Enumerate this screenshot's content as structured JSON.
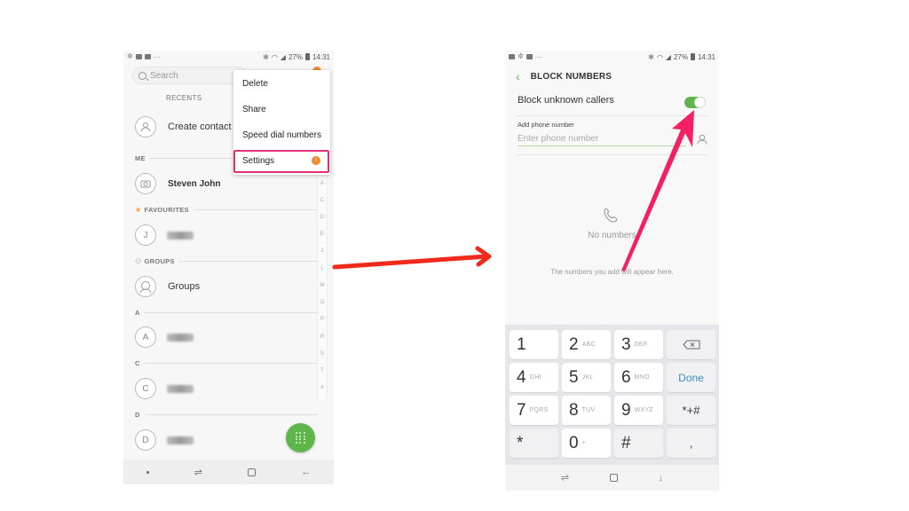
{
  "left_screen": {
    "status_bar": {
      "battery": "27%",
      "time": "14:31"
    },
    "search": {
      "placeholder": "Search"
    },
    "tabs": {
      "recents": "RECENTS"
    },
    "create_contact": "Create contact",
    "sections": {
      "me": "ME",
      "favourites": "FAVOURITES",
      "groups": "GROUPS",
      "a": "A",
      "c": "C",
      "d": "D"
    },
    "me_contact": "Steven John",
    "favourite_contact": {
      "initial": "J",
      "name": "(blurred)"
    },
    "groups_item": "Groups",
    "contacts": [
      {
        "initial": "A",
        "name": "(blurred)"
      },
      {
        "initial": "C",
        "name": "(blurred)"
      },
      {
        "initial": "D",
        "name": "(blurred)"
      }
    ],
    "index_letters": [
      "A",
      "C",
      "D",
      "E",
      "J",
      "L",
      "M",
      "O",
      "P",
      "R",
      "S",
      "T",
      "#"
    ],
    "menu": {
      "items": [
        "Delete",
        "Share",
        "Speed dial numbers",
        "Settings"
      ],
      "highlighted": "Settings",
      "settings_badge": "!"
    }
  },
  "right_screen": {
    "status_bar": {
      "battery": "27%",
      "time": "14:31"
    },
    "title": "BLOCK NUMBERS",
    "block_unknown_label": "Block unknown callers",
    "block_unknown_enabled": true,
    "add_phone_label": "Add phone number",
    "phone_input": {
      "placeholder": "Enter phone number",
      "value": ""
    },
    "empty_title": "No numbers",
    "empty_hint": "The numbers you add will appear here.",
    "keypad": [
      {
        "digit": "1",
        "letters": ""
      },
      {
        "digit": "2",
        "letters": "ABC"
      },
      {
        "digit": "3",
        "letters": "DEF"
      },
      {
        "digit": "backspace",
        "letters": ""
      },
      {
        "digit": "4",
        "letters": "GHI"
      },
      {
        "digit": "5",
        "letters": "JKL"
      },
      {
        "digit": "6",
        "letters": "MNO"
      },
      {
        "digit": "Done",
        "letters": ""
      },
      {
        "digit": "7",
        "letters": "PQRS"
      },
      {
        "digit": "8",
        "letters": "TUV"
      },
      {
        "digit": "9",
        "letters": "WXYZ"
      },
      {
        "digit": "*+#",
        "letters": ""
      },
      {
        "digit": "*",
        "letters": ""
      },
      {
        "digit": "0",
        "letters": "+"
      },
      {
        "digit": "#",
        "letters": ""
      },
      {
        "digit": ",",
        "letters": ""
      }
    ]
  },
  "annotations": {
    "arrow_between_colors": "#f02a1a",
    "arrow_to_toggle_color": "#f51f63",
    "highlight_color": "#e0327a",
    "accent_green": "#5fb54a"
  }
}
